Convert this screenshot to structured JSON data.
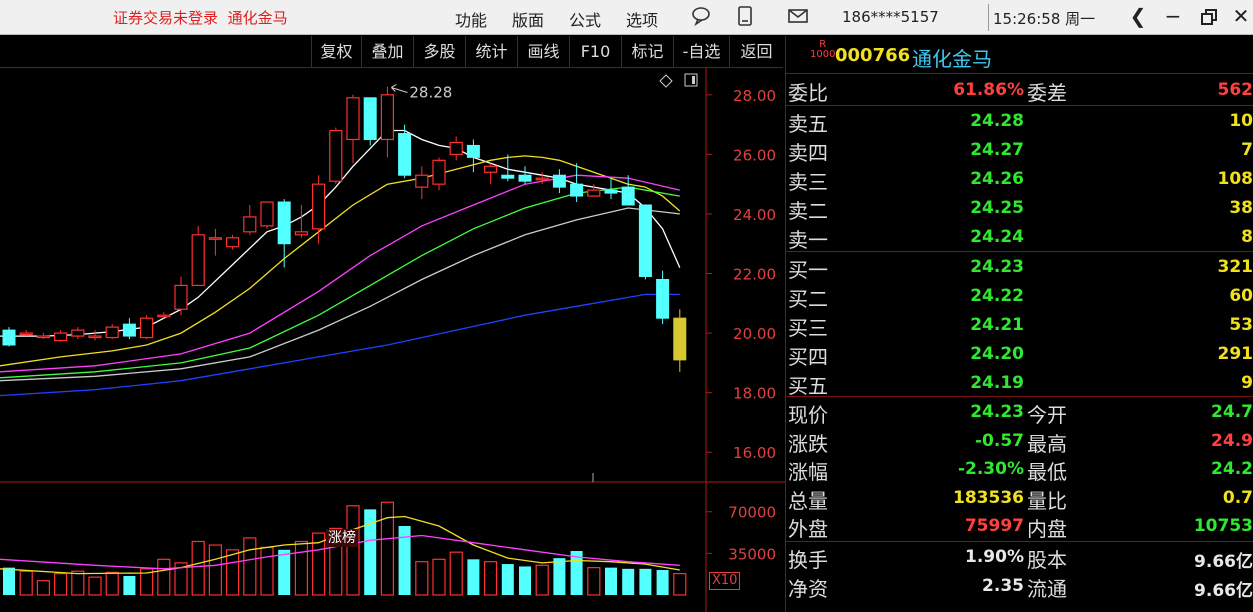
{
  "titlebar": {
    "login_text": "证券交易未登录",
    "stock_name": "通化金马",
    "menus": [
      "功能",
      "版面",
      "公式",
      "选项"
    ],
    "phone": "186****5157",
    "clock": "15:26:58 周一"
  },
  "toolbar": {
    "buttons": [
      "复权",
      "叠加",
      "多股",
      "统计",
      "画线",
      "F10",
      "标记",
      "-自选",
      "返回"
    ]
  },
  "chart": {
    "high_label": "28.28",
    "badge": "涨榜",
    "vol_multiplier": "X10",
    "colors": {
      "up": "#ff3030",
      "down": "#54ffff",
      "ma5": "#ffffff",
      "ma10": "#f0e020",
      "ma20": "#ff40ff",
      "ma30": "#40ff40",
      "ma60": "#cccccc",
      "ma120": "#2040ff"
    }
  },
  "chart_data": {
    "type": "candlestick",
    "price_axis": {
      "ticks": [
        "28.00",
        "26.00",
        "24.00",
        "22.00",
        "20.00",
        "18.00",
        "16.00"
      ],
      "ylim": [
        15.0,
        28.9
      ]
    },
    "volume_axis": {
      "ticks": [
        "70000",
        "35000"
      ],
      "ylim": [
        0,
        95000
      ]
    },
    "candles": [
      {
        "o": 20.1,
        "h": 20.2,
        "l": 19.55,
        "c": 19.6
      },
      {
        "o": 19.95,
        "h": 20.1,
        "l": 19.9,
        "c": 20.0
      },
      {
        "o": 19.9,
        "h": 20.0,
        "l": 19.8,
        "c": 19.9
      },
      {
        "o": 19.75,
        "h": 20.1,
        "l": 19.7,
        "c": 20.0
      },
      {
        "o": 19.9,
        "h": 20.2,
        "l": 19.8,
        "c": 20.1
      },
      {
        "o": 19.85,
        "h": 20.1,
        "l": 19.75,
        "c": 19.9
      },
      {
        "o": 19.85,
        "h": 20.3,
        "l": 19.8,
        "c": 20.2
      },
      {
        "o": 20.3,
        "h": 20.5,
        "l": 19.8,
        "c": 19.9
      },
      {
        "o": 19.85,
        "h": 20.6,
        "l": 19.8,
        "c": 20.5
      },
      {
        "o": 20.6,
        "h": 20.7,
        "l": 20.5,
        "c": 20.6
      },
      {
        "o": 20.8,
        "h": 21.9,
        "l": 20.6,
        "c": 21.6
      },
      {
        "o": 21.6,
        "h": 23.6,
        "l": 21.6,
        "c": 23.3
      },
      {
        "o": 23.2,
        "h": 23.5,
        "l": 22.6,
        "c": 23.2
      },
      {
        "o": 22.9,
        "h": 23.3,
        "l": 22.8,
        "c": 23.2
      },
      {
        "o": 23.4,
        "h": 24.3,
        "l": 23.3,
        "c": 23.9
      },
      {
        "o": 23.6,
        "h": 24.4,
        "l": 23.5,
        "c": 24.4
      },
      {
        "o": 24.4,
        "h": 24.5,
        "l": 22.2,
        "c": 23.0
      },
      {
        "o": 23.3,
        "h": 24.3,
        "l": 23.2,
        "c": 23.4
      },
      {
        "o": 23.5,
        "h": 25.3,
        "l": 23.0,
        "c": 25.0
      },
      {
        "o": 25.1,
        "h": 26.9,
        "l": 25.0,
        "c": 26.8
      },
      {
        "o": 26.5,
        "h": 28.0,
        "l": 25.7,
        "c": 27.9
      },
      {
        "o": 27.9,
        "h": 27.9,
        "l": 26.3,
        "c": 26.5
      },
      {
        "o": 26.5,
        "h": 28.28,
        "l": 25.9,
        "c": 28.0
      },
      {
        "o": 26.7,
        "h": 27.0,
        "l": 25.2,
        "c": 25.3
      },
      {
        "o": 24.9,
        "h": 25.6,
        "l": 24.5,
        "c": 25.3
      },
      {
        "o": 25.0,
        "h": 25.9,
        "l": 24.8,
        "c": 25.8
      },
      {
        "o": 26.0,
        "h": 26.6,
        "l": 25.8,
        "c": 26.4
      },
      {
        "o": 26.3,
        "h": 26.5,
        "l": 25.4,
        "c": 25.9
      },
      {
        "o": 25.4,
        "h": 25.7,
        "l": 25.0,
        "c": 25.6
      },
      {
        "o": 25.3,
        "h": 26.0,
        "l": 25.1,
        "c": 25.2
      },
      {
        "o": 25.3,
        "h": 25.6,
        "l": 25.0,
        "c": 25.1
      },
      {
        "o": 25.2,
        "h": 25.4,
        "l": 25.0,
        "c": 25.2
      },
      {
        "o": 25.3,
        "h": 25.5,
        "l": 24.7,
        "c": 24.9
      },
      {
        "o": 25.0,
        "h": 25.7,
        "l": 24.4,
        "c": 24.6
      },
      {
        "o": 24.6,
        "h": 25.0,
        "l": 24.6,
        "c": 24.8
      },
      {
        "o": 24.8,
        "h": 25.2,
        "l": 24.5,
        "c": 24.7
      },
      {
        "o": 24.9,
        "h": 25.3,
        "l": 24.3,
        "c": 24.3
      },
      {
        "o": 24.3,
        "h": 24.3,
        "l": 21.8,
        "c": 21.9
      },
      {
        "o": 21.8,
        "h": 22.1,
        "l": 20.3,
        "c": 20.5
      },
      {
        "o": 19.1,
        "h": 20.8,
        "l": 18.7,
        "c": 20.5
      }
    ],
    "volumes": [
      23000,
      20000,
      12000,
      18000,
      20000,
      15000,
      19000,
      16000,
      22000,
      30000,
      27000,
      45000,
      42000,
      38000,
      48000,
      40000,
      38000,
      45000,
      52000,
      56000,
      75000,
      72000,
      78000,
      58000,
      28000,
      30000,
      36000,
      30000,
      28000,
      26000,
      24000,
      25000,
      31000,
      37000,
      23000,
      23000,
      22000,
      22000,
      21000,
      18000
    ],
    "ma_lines": [
      {
        "key": "ma5",
        "points": [
          [
            0,
            19.9
          ],
          [
            2,
            19.9
          ],
          [
            4,
            19.95
          ],
          [
            6,
            20.05
          ],
          [
            8,
            20.2
          ],
          [
            10,
            20.8
          ],
          [
            11,
            21.2
          ],
          [
            13,
            22.3
          ],
          [
            15,
            23.4
          ],
          [
            16,
            23.6
          ],
          [
            17,
            23.9
          ],
          [
            18,
            24.3
          ],
          [
            19,
            24.9
          ],
          [
            20,
            25.6
          ],
          [
            21,
            26.2
          ],
          [
            22,
            26.8
          ],
          [
            23,
            26.8
          ],
          [
            24,
            26.5
          ],
          [
            25,
            26.3
          ],
          [
            26,
            26.2
          ],
          [
            27,
            25.9
          ],
          [
            28,
            25.7
          ],
          [
            29,
            25.5
          ],
          [
            30,
            25.4
          ],
          [
            31,
            25.3
          ],
          [
            32,
            25.2
          ],
          [
            33,
            25.0
          ],
          [
            34,
            24.9
          ],
          [
            35,
            24.8
          ],
          [
            36,
            24.7
          ],
          [
            37,
            24.2
          ],
          [
            38,
            23.5
          ],
          [
            39,
            22.2
          ]
        ]
      },
      {
        "key": "ma10",
        "points": [
          [
            0,
            18.9
          ],
          [
            3,
            19.2
          ],
          [
            6,
            19.4
          ],
          [
            8,
            19.6
          ],
          [
            10,
            20.0
          ],
          [
            12,
            20.7
          ],
          [
            14,
            21.5
          ],
          [
            16,
            22.5
          ],
          [
            18,
            23.4
          ],
          [
            20,
            24.3
          ],
          [
            22,
            25.0
          ],
          [
            24,
            25.2
          ],
          [
            26,
            25.5
          ],
          [
            28,
            25.8
          ],
          [
            29,
            25.9
          ],
          [
            30,
            25.95
          ],
          [
            31,
            25.9
          ],
          [
            32,
            25.8
          ],
          [
            33,
            25.6
          ],
          [
            34,
            25.4
          ],
          [
            35,
            25.2
          ],
          [
            36,
            25.0
          ],
          [
            37,
            24.9
          ],
          [
            38,
            24.6
          ],
          [
            39,
            24.1
          ]
        ]
      },
      {
        "key": "ma20",
        "points": [
          [
            0,
            18.7
          ],
          [
            5,
            18.9
          ],
          [
            10,
            19.3
          ],
          [
            14,
            20.0
          ],
          [
            18,
            21.4
          ],
          [
            21,
            22.6
          ],
          [
            24,
            23.6
          ],
          [
            27,
            24.3
          ],
          [
            30,
            25.0
          ],
          [
            33,
            25.3
          ],
          [
            36,
            25.2
          ],
          [
            39,
            24.8
          ]
        ]
      },
      {
        "key": "ma30",
        "points": [
          [
            0,
            18.5
          ],
          [
            5,
            18.7
          ],
          [
            10,
            19.0
          ],
          [
            14,
            19.5
          ],
          [
            18,
            20.6
          ],
          [
            21,
            21.6
          ],
          [
            24,
            22.6
          ],
          [
            27,
            23.5
          ],
          [
            30,
            24.2
          ],
          [
            33,
            24.7
          ],
          [
            36,
            24.9
          ],
          [
            39,
            24.6
          ]
        ]
      },
      {
        "key": "ma60",
        "points": [
          [
            0,
            18.4
          ],
          [
            5,
            18.55
          ],
          [
            10,
            18.8
          ],
          [
            14,
            19.2
          ],
          [
            18,
            20.1
          ],
          [
            21,
            20.9
          ],
          [
            24,
            21.8
          ],
          [
            27,
            22.6
          ],
          [
            30,
            23.3
          ],
          [
            33,
            23.8
          ],
          [
            36,
            24.2
          ],
          [
            39,
            24.0
          ]
        ]
      },
      {
        "key": "ma120",
        "points": [
          [
            0,
            17.9
          ],
          [
            5,
            18.1
          ],
          [
            10,
            18.4
          ],
          [
            14,
            18.8
          ],
          [
            18,
            19.2
          ],
          [
            22,
            19.6
          ],
          [
            26,
            20.1
          ],
          [
            30,
            20.6
          ],
          [
            34,
            21.0
          ],
          [
            37,
            21.3
          ],
          [
            39,
            21.3
          ]
        ]
      }
    ],
    "volume_ma_lines": [
      {
        "key": "ma5",
        "points": [
          [
            0,
            22000
          ],
          [
            4,
            18000
          ],
          [
            8,
            18500
          ],
          [
            10,
            23000
          ],
          [
            12,
            30000
          ],
          [
            14,
            38000
          ],
          [
            16,
            42000
          ],
          [
            18,
            44000
          ],
          [
            20,
            55000
          ],
          [
            22,
            65000
          ],
          [
            23,
            66000
          ],
          [
            25,
            58000
          ],
          [
            27,
            42000
          ],
          [
            29,
            31000
          ],
          [
            31,
            27000
          ],
          [
            33,
            29000
          ],
          [
            35,
            28000
          ],
          [
            37,
            26000
          ],
          [
            39,
            21000
          ]
        ]
      },
      {
        "key": "ma10",
        "points": [
          [
            0,
            30000
          ],
          [
            5,
            25000
          ],
          [
            9,
            22000
          ],
          [
            12,
            25000
          ],
          [
            15,
            32000
          ],
          [
            18,
            38000
          ],
          [
            21,
            46000
          ],
          [
            24,
            50000
          ],
          [
            27,
            44000
          ],
          [
            30,
            38000
          ],
          [
            33,
            32000
          ],
          [
            36,
            28000
          ],
          [
            39,
            25000
          ]
        ]
      }
    ]
  },
  "quote": {
    "flag_top": "R",
    "flag_bottom": "1000",
    "code": "000766",
    "name": "通化金马",
    "weibi_label": "委比",
    "weibi_value": "61.86%",
    "weicha_label": "委差",
    "weicha_value": "562",
    "asks": [
      {
        "label": "卖五",
        "price": "24.28",
        "vol": "10"
      },
      {
        "label": "卖四",
        "price": "24.27",
        "vol": "7"
      },
      {
        "label": "卖三",
        "price": "24.26",
        "vol": "108"
      },
      {
        "label": "卖二",
        "price": "24.25",
        "vol": "38"
      },
      {
        "label": "卖一",
        "price": "24.24",
        "vol": "8"
      }
    ],
    "bids": [
      {
        "label": "买一",
        "price": "24.23",
        "vol": "321"
      },
      {
        "label": "买二",
        "price": "24.22",
        "vol": "60"
      },
      {
        "label": "买三",
        "price": "24.21",
        "vol": "53"
      },
      {
        "label": "买四",
        "price": "24.20",
        "vol": "291"
      },
      {
        "label": "买五",
        "price": "24.19",
        "vol": "9"
      }
    ],
    "stats": [
      {
        "l1": "现价",
        "v1": "24.23",
        "c1": "green",
        "l2": "今开",
        "v2": "24.7",
        "c2": "green"
      },
      {
        "l1": "涨跌",
        "v1": "-0.57",
        "c1": "green",
        "l2": "最高",
        "v2": "24.9",
        "c2": "red"
      },
      {
        "l1": "涨幅",
        "v1": "-2.30%",
        "c1": "green",
        "l2": "最低",
        "v2": "24.2",
        "c2": "green"
      },
      {
        "l1": "总量",
        "v1": "183536",
        "c1": "yellow",
        "l2": "量比",
        "v2": "0.7",
        "c2": "yellow"
      },
      {
        "l1": "外盘",
        "v1": "75997",
        "c1": "red",
        "l2": "内盘",
        "v2": "10753",
        "c2": "green"
      }
    ],
    "stats2": [
      {
        "l1": "换手",
        "v1": "1.90%",
        "l2": "股本",
        "v2": "9.66亿"
      },
      {
        "l1": "净资",
        "v1": "2.35",
        "l2": "流通",
        "v2": "9.66亿"
      }
    ]
  }
}
